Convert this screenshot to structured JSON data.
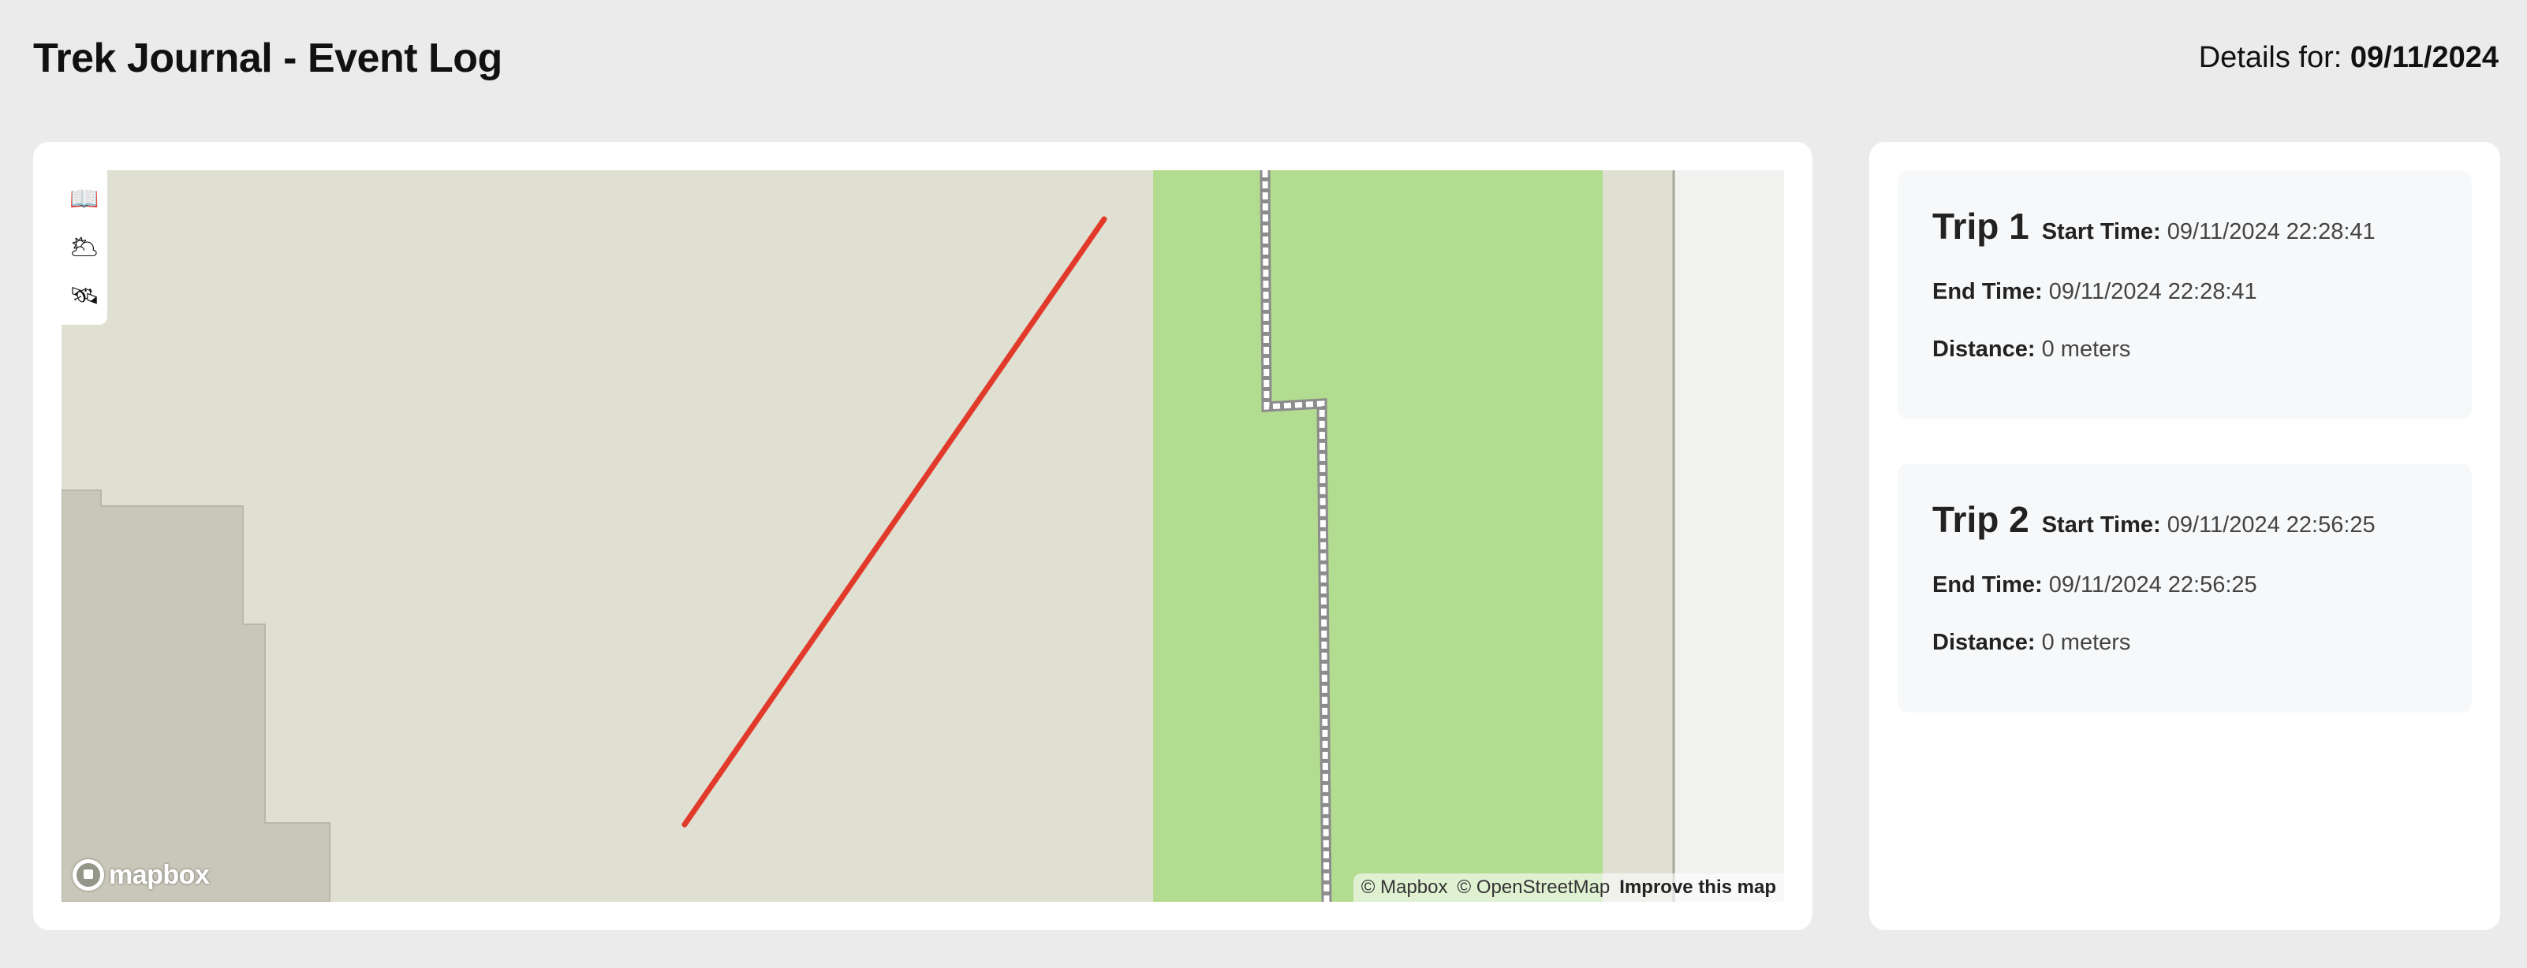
{
  "header": {
    "title": "Trek Journal - Event Log",
    "details_label": "Details for:",
    "details_date": "09/11/2024"
  },
  "map": {
    "controls": [
      {
        "name": "book-icon",
        "glyph": "📖"
      },
      {
        "name": "weather-icon",
        "glyph": "🌥"
      },
      {
        "name": "satellite-icon",
        "glyph": "🛰"
      }
    ],
    "logo_text": "mapbox",
    "attribution": {
      "mapbox": "© Mapbox",
      "osm": "© OpenStreetMap",
      "improve": "Improve this map"
    },
    "colors": {
      "land": "#dfdfd2",
      "building": "#c8c7b9",
      "park": "#b2dc8f",
      "route": "#e13a2b"
    }
  },
  "trips": [
    {
      "name": "Trip 1",
      "start_label": "Start Time:",
      "start_time": "09/11/2024 22:28:41",
      "end_label": "End Time:",
      "end_time": "09/11/2024 22:28:41",
      "distance_label": "Distance:",
      "distance": "0 meters"
    },
    {
      "name": "Trip 2",
      "start_label": "Start Time:",
      "start_time": "09/11/2024 22:56:25",
      "end_label": "End Time:",
      "end_time": "09/11/2024 22:56:25",
      "distance_label": "Distance:",
      "distance": "0 meters"
    }
  ]
}
